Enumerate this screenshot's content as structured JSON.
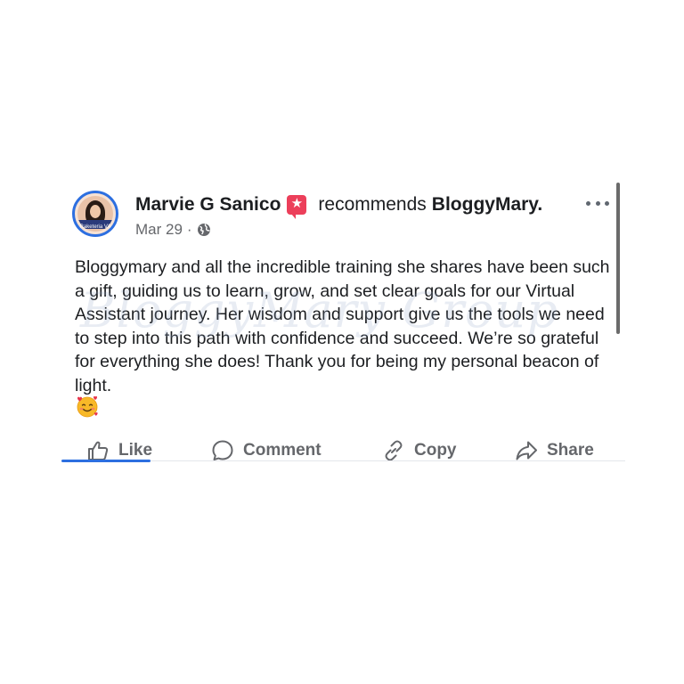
{
  "post": {
    "author_name": "Marvie G Sanico",
    "badge_icon": "star-badge-icon",
    "recommends_text": "recommends",
    "page_name": "BloggyMary.",
    "date": "Mar 29",
    "meta_separator": "·",
    "privacy_icon": "globe-icon",
    "avatar_caption": "Raketeria VA",
    "body": "Bloggymary and all the incredible training she shares have been such a gift, guiding us to learn, grow, and set clear goals for our Virtual Assistant journey. Her wisdom and support give us the tools we need to step into this path with confidence and succeed. We’re so grateful for everything she does! Thank you for being my personal beacon of light.",
    "emoji": "smiling-face-with-hearts",
    "watermark": "BloggyMary Group"
  },
  "actions": {
    "like": "Like",
    "comment": "Comment",
    "copy": "Copy",
    "share": "Share"
  },
  "colors": {
    "accent": "#2d6fe0",
    "badge": "#ec3f5a",
    "text": "#1c1e21",
    "muted": "#65676b"
  }
}
